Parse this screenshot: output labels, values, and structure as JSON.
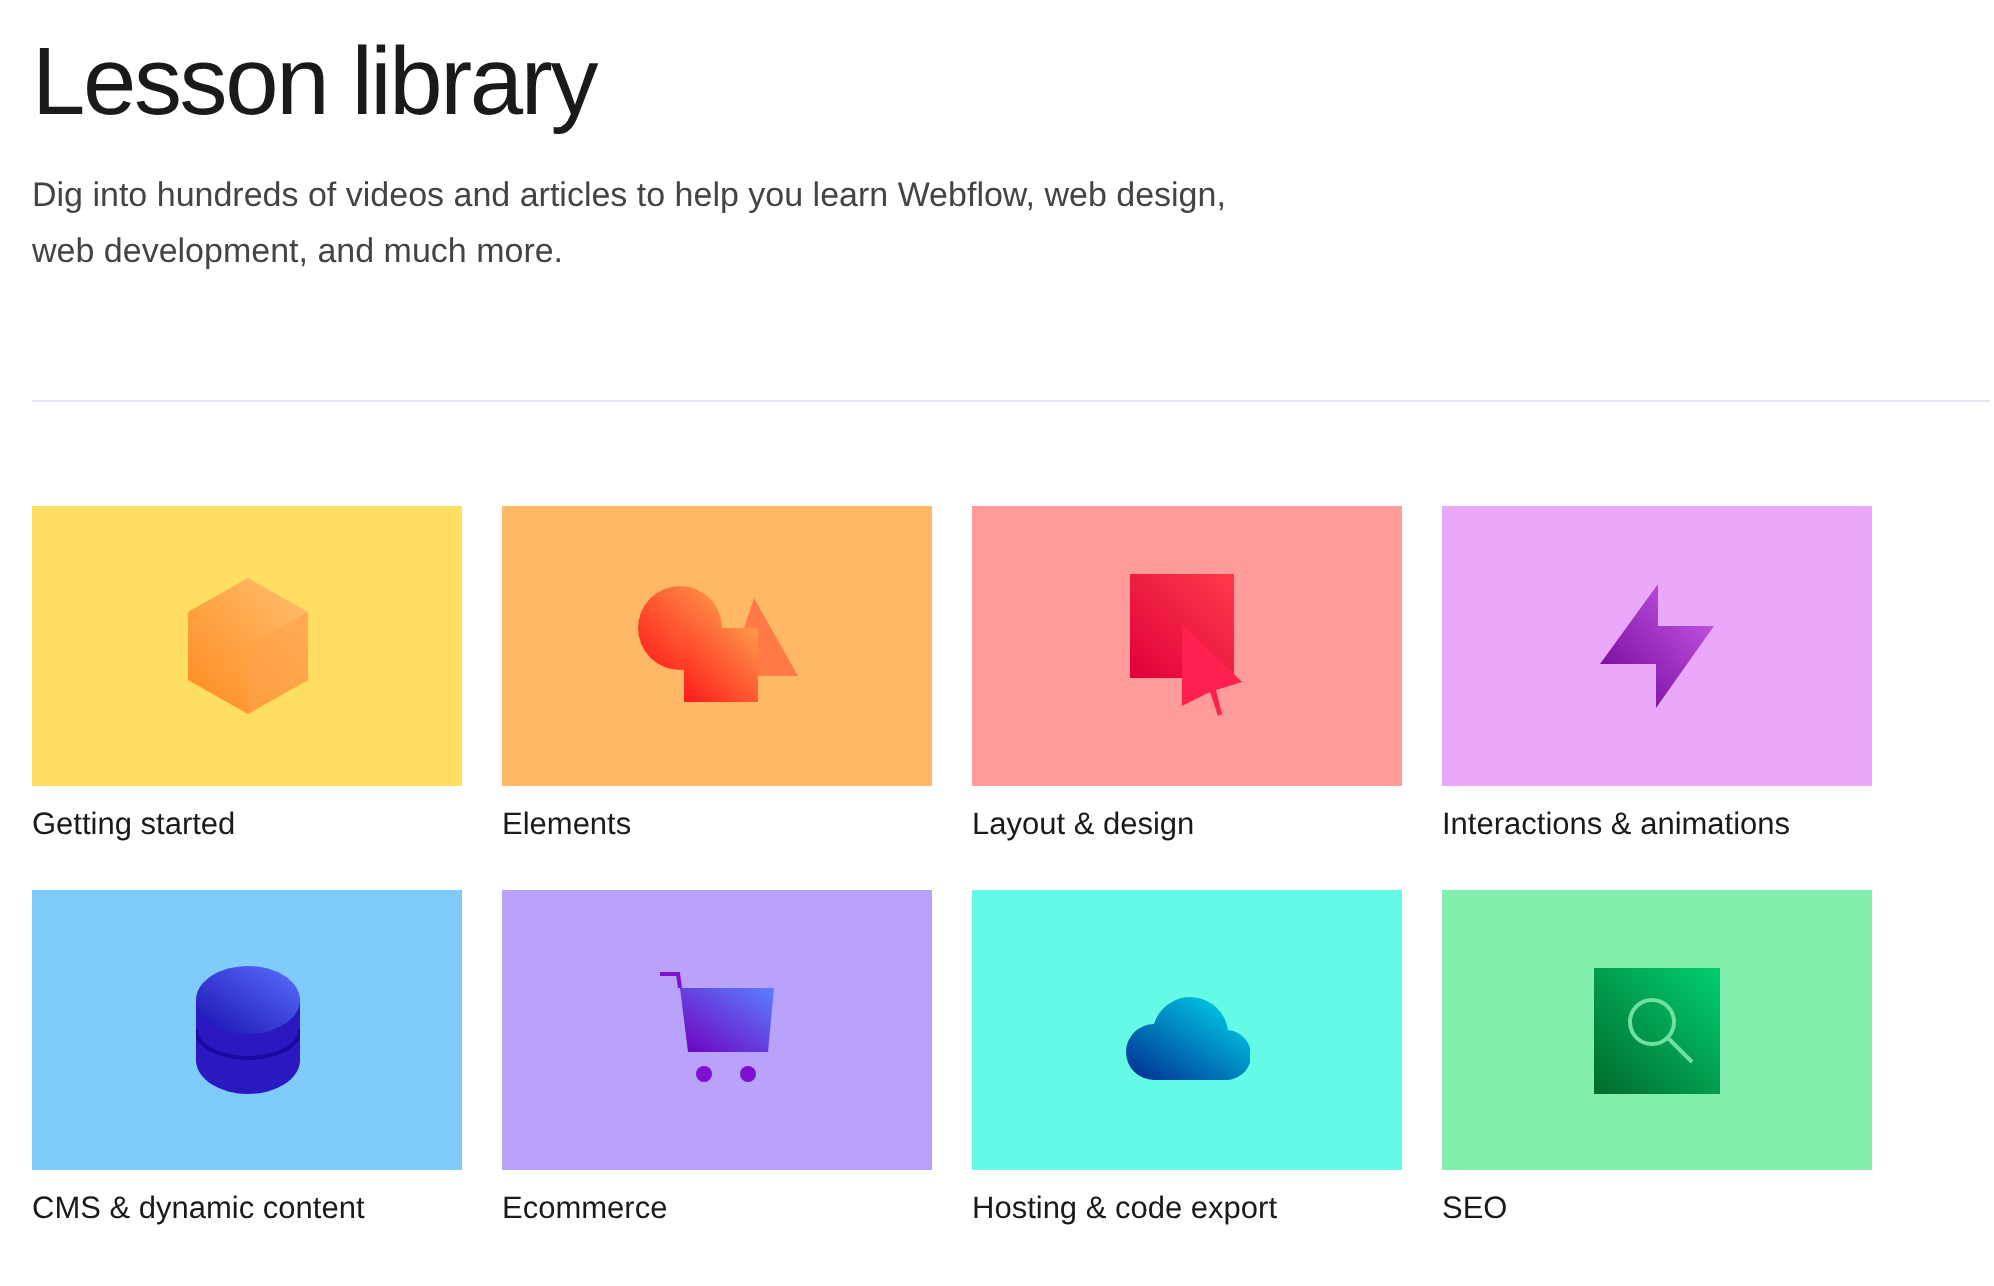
{
  "header": {
    "title": "Lesson library",
    "description": "Dig into hundreds of videos and articles to help you learn Webflow, web design, web development, and much more."
  },
  "categories": [
    {
      "label": "Getting started",
      "kind": "cube",
      "color": "#ffde61"
    },
    {
      "label": "Elements",
      "kind": "shapes",
      "color": "#ffb866"
    },
    {
      "label": "Layout & design",
      "kind": "cursor",
      "color": "#ff9b9b"
    },
    {
      "label": "Interactions & animations",
      "kind": "lightning",
      "color": "#eaa8fa"
    },
    {
      "label": "CMS & dynamic content",
      "kind": "database",
      "color": "#7ecbfc"
    },
    {
      "label": "Ecommerce",
      "kind": "cart",
      "color": "#b9a2fb"
    },
    {
      "label": "Hosting & code export",
      "kind": "cloud",
      "color": "#65fae6"
    },
    {
      "label": "SEO",
      "kind": "seo",
      "color": "#82eeac"
    }
  ]
}
